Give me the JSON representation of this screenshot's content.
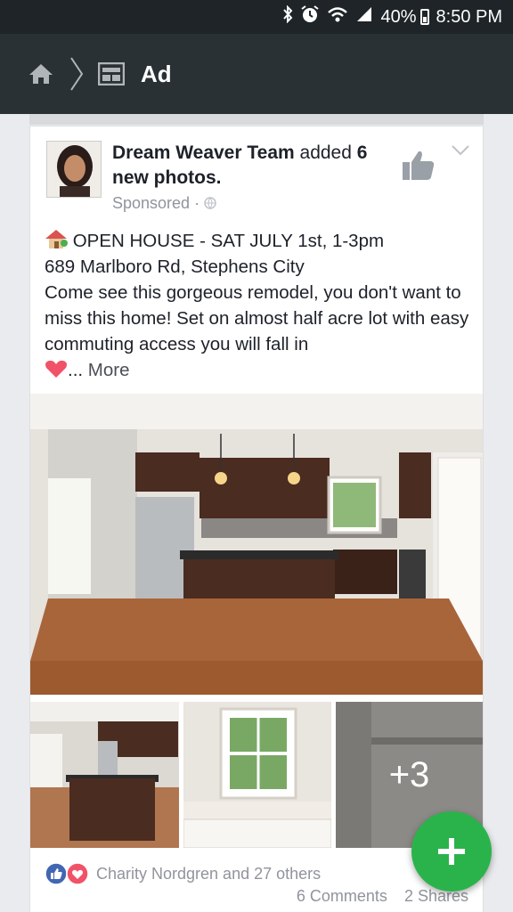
{
  "status_bar": {
    "battery": "40%",
    "time": "8:50 PM",
    "icons": [
      "bluetooth-icon",
      "alarm-icon",
      "wifi-icon",
      "signal-icon",
      "battery-icon"
    ]
  },
  "toolbar": {
    "title": "Ad",
    "icons": [
      "home-icon",
      "breadcrumb-separator-icon",
      "ad-icon"
    ]
  },
  "post": {
    "author": "Dream Weaver Team",
    "action_prefix": "added",
    "action_count": "6",
    "action_suffix": "new photos.",
    "sponsored": "Sponsored ·",
    "line1": "OPEN HOUSE - SAT JULY 1st, 1-3pm",
    "line2": "689 Marlboro Rd, Stephens City",
    "line3": "Come see this gorgeous remodel, you don't want to miss this home! Set on almost half acre lot with easy commuting access you will fall in",
    "ellipsis": "...",
    "more": "More",
    "extra_photos": "+3"
  },
  "reactions": {
    "names": "Charity Nordgren and 27 others",
    "comments": "6 Comments",
    "shares": "2 Shares"
  },
  "colors": {
    "status_bar": "#1e2427",
    "toolbar": "#2a3134",
    "fab": "#2bb34b",
    "like_blue": "#4267b2",
    "love_red": "#f25268"
  }
}
